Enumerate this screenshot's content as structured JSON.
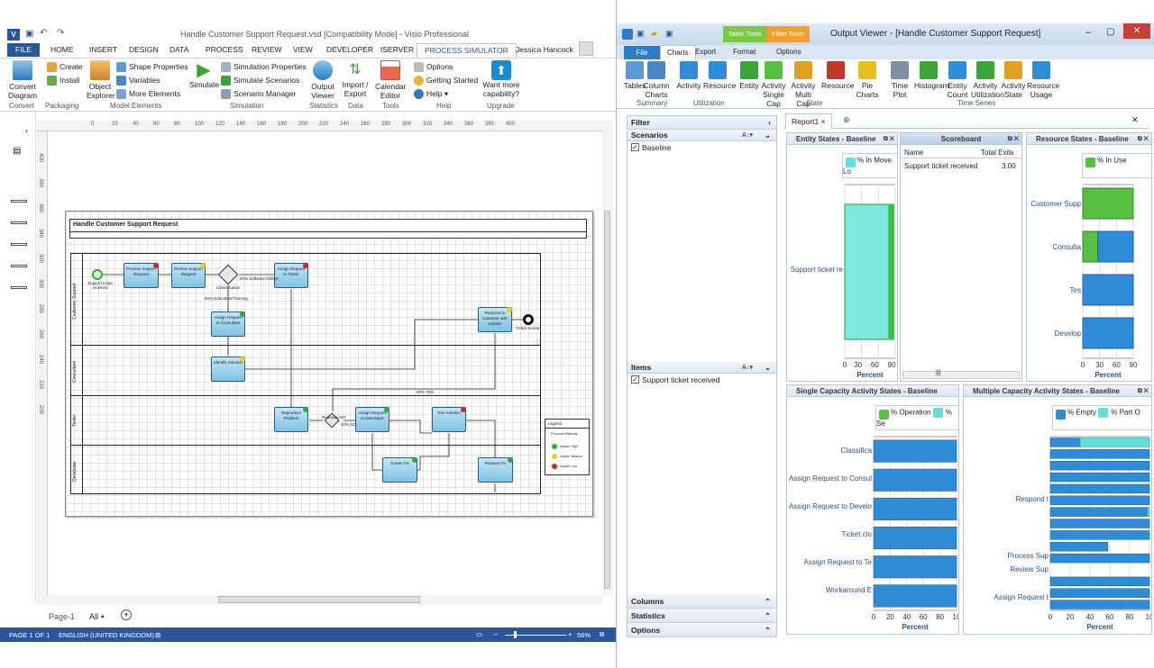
{
  "visio": {
    "title": "Handle Customer Support Request.vsd  [Compatibility Mode] - Visio Professional",
    "user": "Jessica Hancock",
    "tabs": [
      "FILE",
      "HOME",
      "INSERT",
      "DESIGN",
      "DATA",
      "PROCESS",
      "REVIEW",
      "VIEW",
      "DEVELOPER",
      "ISERVER",
      "PROCESS SIMULATOR"
    ],
    "ribbon": {
      "convert_diagram": "Convert Diagram",
      "create": "Create",
      "install": "Install",
      "object_explorer": "Object Explorer",
      "shape_properties": "Shape Properties",
      "variables": "Variables",
      "more_elements": "More Elements",
      "simulate": "Simulate",
      "simulation_properties": "Simulation Properties",
      "simulate_scenarios": "Simulate Scenarios",
      "scenario_manager": "Scenario Manager",
      "output_viewer": "Output Viewer",
      "import_export": "Import / Export",
      "calendar_editor": "Calendar Editor",
      "options": "Options",
      "getting_started": "Getting Started",
      "help": "Help",
      "want_more": "Want more capability?",
      "groups": [
        "Convert",
        "Packaging",
        "Model Elements",
        "Simulation",
        "Statistics",
        "Data",
        "Tools",
        "Help",
        "Upgrade"
      ]
    },
    "ruler_h": [
      "0",
      "20",
      "40",
      "60",
      "80",
      "100",
      "120",
      "140",
      "160",
      "180",
      "200",
      "220",
      "240",
      "260",
      "280",
      "300",
      "320",
      "340",
      "360",
      "380",
      "400"
    ],
    "ruler_v": [
      "400",
      "380",
      "360",
      "340",
      "320",
      "300",
      "280",
      "260",
      "240",
      "220",
      "200"
    ],
    "diagram": {
      "title": "Handle Customer Support Request",
      "lanes": [
        "Customer Support",
        "Consultant",
        "Tester",
        "Developer"
      ],
      "start": "Support ticket received",
      "end": "Ticket closed",
      "tasks": [
        "Process Support Request",
        "Review Support Request",
        "Assign Request to Tester",
        "Assign Request to Consultant",
        "Identify Solution",
        "Respond to customer with solution",
        "Reproduce Problem",
        "Assign Request to Developer",
        "Test Solution",
        "Create Fix",
        "Release Fix"
      ],
      "gateway": "Classification",
      "labels": [
        "50% Software Defect",
        "50% Education/Training",
        "80% YES",
        "40% NO",
        "Reproduced?"
      ],
      "legend_title": "Legend",
      "legend_sub": "Process Maturity",
      "legend_items": [
        "Impact: High",
        "Impact: Medium",
        "Impact: Low"
      ]
    },
    "page_tabs": [
      "Page-1",
      "All"
    ],
    "status": {
      "page": "PAGE 1 OF 1",
      "lang": "ENGLISH (UNITED KINGDOM)",
      "zoom": "56%"
    }
  },
  "ov": {
    "title": "Output Viewer - [Handle Customer Support Request]",
    "context_tabs": [
      "Table Tools",
      "Filter Tools"
    ],
    "tabs": [
      "File",
      "Charts",
      "Export",
      "Format",
      "Options"
    ],
    "ribbon": [
      "Tables",
      "Column Charts",
      "Activity",
      "Resource",
      "Entity",
      "Activity Single Cap",
      "Activity Multi Cap",
      "Resource",
      "Pie Charts",
      "Time Plot",
      "Histogram",
      "Entity Count",
      "Activity Utilization",
      "Activity State",
      "Resource Usage"
    ],
    "groups": [
      "Summary",
      "Utilization",
      "State",
      "Time Series"
    ],
    "filter": {
      "title": "Filter",
      "scenarios": "Scenarios",
      "baseline": "Baseline",
      "items": "Items",
      "item1": "Support ticket received",
      "columns": "Columns",
      "statistics": "Statistics",
      "options": "Options"
    },
    "report_tab": "Report1",
    "scoreboard": {
      "title": "Scoreboard",
      "col_name": "Name",
      "col_exits": "Total Exits",
      "row_name": "Support ticket received",
      "row_exits": "3.00"
    },
    "entity": {
      "title": "Entity States - Baseline",
      "legend": "% In Move Lo",
      "category": "Support ticket re",
      "ticks": [
        "30",
        "60",
        "90"
      ],
      "first_tick": "0",
      "xlabel": "Percent"
    },
    "resource": {
      "title": "Resource States - Baseline",
      "legend": "% In Use",
      "categories": [
        "Customer Supp",
        "Consulta",
        "Tes",
        "Develop"
      ],
      "ticks": [
        "0",
        "30",
        "60",
        "90"
      ],
      "xlabel": "Percent"
    },
    "single": {
      "title": "Single Capacity Activity States - Baseline",
      "legend1": "% Operation",
      "legend2": "% Se",
      "categories": [
        "Classifica",
        "Assign Request to Consul",
        "Assign Request to Develo",
        "Ticket clo",
        "Assign Request to Te",
        "Workaround E"
      ],
      "ticks": [
        "0",
        "20",
        "40",
        "60",
        "80",
        "10"
      ],
      "xlabel": "Percent"
    },
    "multi": {
      "title": "Multiple Capacity Activity States - Baseline",
      "legend1": "% Empty",
      "legend2": "% Part O",
      "categories": [
        "Respond t",
        "Process Sup",
        "Review Sup",
        "Assign Request t"
      ],
      "ticks": [
        "0",
        "20",
        "40",
        "60",
        "80",
        "10"
      ],
      "xlabel": "Percent"
    }
  },
  "chart_data": [
    {
      "type": "bar",
      "title": "Entity States - Baseline",
      "categories": [
        "Support ticket re"
      ],
      "series": [
        {
          "name": "% In Move Lo",
          "values": [
            97
          ]
        }
      ],
      "xlabel": "Percent",
      "xlim": [
        0,
        100
      ]
    },
    {
      "type": "bar",
      "title": "Resource States - Baseline",
      "categories": [
        "Customer Supp",
        "Consulta",
        "Tes",
        "Develop"
      ],
      "series": [
        {
          "name": "% In Use",
          "values": [
            100,
            30,
            0,
            0
          ]
        }
      ],
      "xlabel": "Percent",
      "xlim": [
        0,
        100
      ]
    },
    {
      "type": "bar",
      "title": "Single Capacity Activity States - Baseline",
      "categories": [
        "Classifica",
        "Assign Request to Consul",
        "Assign Request to Develo",
        "Ticket clo",
        "Assign Request to Te",
        "Workaround E"
      ],
      "series": [
        {
          "name": "% Operation",
          "values": [
            100,
            100,
            100,
            100,
            100,
            100
          ]
        }
      ],
      "xlabel": "Percent",
      "xlim": [
        0,
        100
      ]
    },
    {
      "type": "bar",
      "title": "Multiple Capacity Activity States - Baseline",
      "categories": [
        "Respond t",
        "Process Sup",
        "Review Sup",
        "Assign Request t"
      ],
      "series": [
        {
          "name": "% Empty",
          "values": [
            30,
            100,
            100,
            100,
            100,
            100,
            98,
            100,
            100,
            58,
            100,
            0,
            100,
            100,
            100
          ]
        },
        {
          "name": "% Part O",
          "values": [
            70,
            0,
            0,
            0,
            0,
            0,
            2,
            0,
            0,
            0,
            0,
            0,
            0,
            0,
            0
          ]
        }
      ],
      "xlabel": "Percent",
      "xlim": [
        0,
        100
      ]
    }
  ]
}
